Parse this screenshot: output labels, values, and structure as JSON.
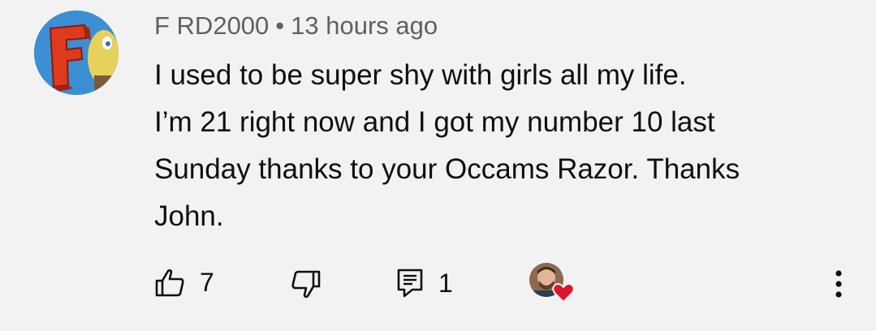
{
  "comment": {
    "author": "F RD2000",
    "separator": "•",
    "timestamp": "13 hours ago",
    "text_lines": [
      "I used to be super shy with girls all my life.",
      "I’m 21 right now and I got my number 10 last",
      "Sunday thanks to your Occams Razor. Thanks",
      "John."
    ],
    "avatar_letter": "F"
  },
  "actions": {
    "like_count": "7",
    "reply_count": "1",
    "icons": {
      "like": "thumbs-up-icon",
      "dislike": "thumbs-down-icon",
      "reply": "comment-icon",
      "creator_heart": "heart-icon",
      "more": "more-vertical-icon"
    }
  },
  "colors": {
    "background": "#f2f2f2",
    "meta_text": "#606060",
    "heart": "#e0142c"
  }
}
